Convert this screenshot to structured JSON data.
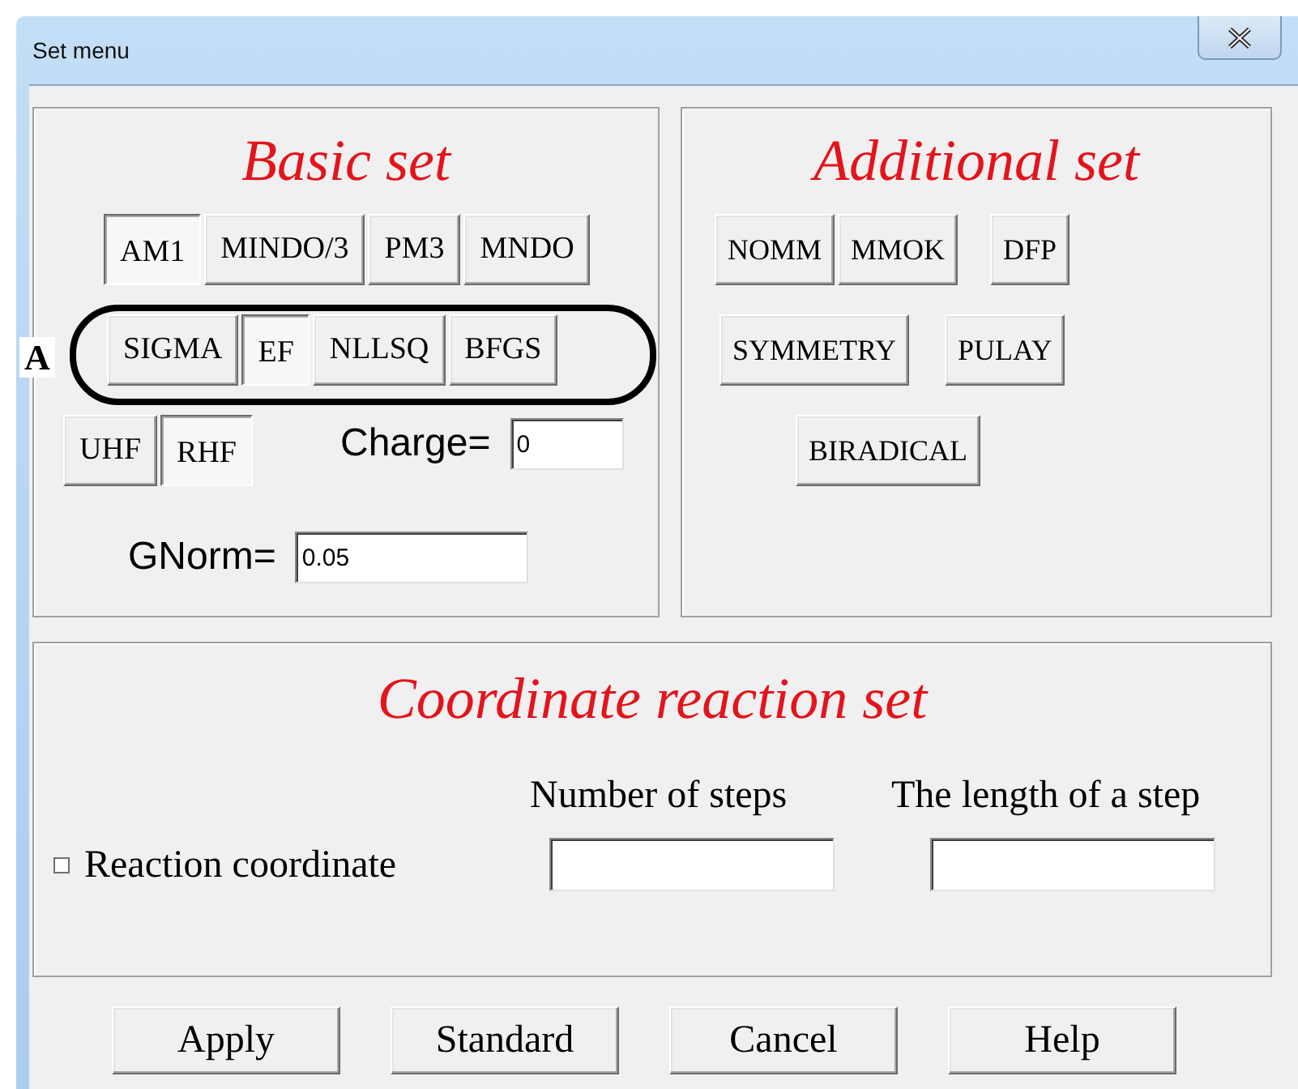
{
  "window": {
    "title": "Set menu"
  },
  "annotation": {
    "label": "A"
  },
  "basic_set": {
    "title": "Basic set",
    "methods": [
      {
        "label": "AM1",
        "selected": true
      },
      {
        "label": "MINDO/3",
        "selected": false
      },
      {
        "label": "PM3",
        "selected": false
      },
      {
        "label": "MNDO",
        "selected": false
      }
    ],
    "optimizers": [
      {
        "label": "SIGMA",
        "selected": false
      },
      {
        "label": "EF",
        "selected": true
      },
      {
        "label": "NLLSQ",
        "selected": false
      },
      {
        "label": "BFGS",
        "selected": false
      }
    ],
    "wavefunctions": [
      {
        "label": "UHF",
        "selected": false
      },
      {
        "label": "RHF",
        "selected": true
      }
    ],
    "charge": {
      "label": "Charge=",
      "value": "0"
    },
    "gnorm": {
      "label": "GNorm=",
      "value": "0.05"
    }
  },
  "additional_set": {
    "title": "Additional set",
    "buttons": [
      "NOMM",
      "MMOK",
      "DFP",
      "SYMMETRY",
      "PULAY",
      "BIRADICAL"
    ]
  },
  "coordinate_reaction_set": {
    "title": "Coordinate reaction set",
    "reaction_coordinate": {
      "label": "Reaction coordinate",
      "checked": false
    },
    "number_of_steps": {
      "label": "Number of steps"
    },
    "step_length": {
      "label": "The length of a step"
    }
  },
  "buttons": [
    "Apply",
    "Standard",
    "Cancel",
    "Help"
  ]
}
